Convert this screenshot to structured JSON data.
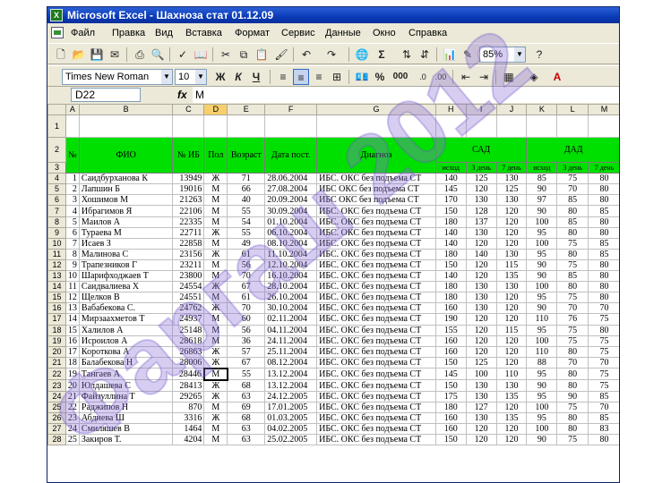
{
  "window": {
    "title": "Microsoft Excel - Шахноза стат 01.12.09",
    "app_icon_letter": "X"
  },
  "menu": [
    "Файл",
    "Правка",
    "Вид",
    "Вставка",
    "Формат",
    "Сервис",
    "Данные",
    "Окно",
    "Справка"
  ],
  "toolbar": {
    "zoom": "85%",
    "font_name": "Times New Roman",
    "font_size": "10",
    "bold": "Ж",
    "italic": "К",
    "underline": "Ч",
    "sigma": "Σ",
    "percent": "%",
    "thousands": "000"
  },
  "formula": {
    "name_box": "D22",
    "fx": "fx",
    "value": "М"
  },
  "columns": [
    "A",
    "B",
    "C",
    "D",
    "E",
    "F",
    "G",
    "H",
    "I",
    "J",
    "K",
    "L",
    "M"
  ],
  "header_row": {
    "num": "№",
    "fio": "ФИО",
    "ib": "№ ИБ",
    "sex": "Пол",
    "age": "Возраст",
    "date": "Дата пост.",
    "diag": "Диагноз",
    "sad": "САД",
    "dad": "ДАД"
  },
  "sub_header": [
    "исход",
    "3 день",
    "7 день",
    "исход",
    "3 день",
    "7 день"
  ],
  "rows": [
    {
      "r": "4",
      "n": "1",
      "fio": "Саидбурханова К",
      "ib": "13949",
      "sex": "Ж",
      "age": "71",
      "date": "28.06.2004",
      "diag": "ИБС. ОКС без подъема СТ",
      "v": [
        "140",
        "125",
        "130",
        "85",
        "75",
        "80"
      ]
    },
    {
      "r": "5",
      "n": "2",
      "fio": "Лапшин Б",
      "ib": "19016",
      "sex": "М",
      "age": "66",
      "date": "27.08.2004",
      "diag": "ИБС ОКС без подъема СТ",
      "v": [
        "145",
        "120",
        "125",
        "90",
        "70",
        "80"
      ]
    },
    {
      "r": "6",
      "n": "3",
      "fio": "Хошимов М",
      "ib": "21263",
      "sex": "М",
      "age": "40",
      "date": "20.09.2004",
      "diag": "ИБС ОКС без подъема СТ",
      "v": [
        "170",
        "130",
        "130",
        "97",
        "85",
        "80"
      ]
    },
    {
      "r": "7",
      "n": "4",
      "fio": "Ибрагимов Я",
      "ib": "22106",
      "sex": "М",
      "age": "55",
      "date": "30.09.2004",
      "diag": "ИБС. ОКС без подъема СТ",
      "v": [
        "150",
        "128",
        "120",
        "90",
        "80",
        "85"
      ]
    },
    {
      "r": "8",
      "n": "5",
      "fio": "Маилов А",
      "ib": "22335",
      "sex": "М",
      "age": "54",
      "date": "01.10.2004",
      "diag": "ИБС. ОКС без подъема СТ",
      "v": [
        "180",
        "137",
        "120",
        "100",
        "85",
        "80"
      ]
    },
    {
      "r": "9",
      "n": "6",
      "fio": "Тураева М",
      "ib": "22711",
      "sex": "Ж",
      "age": "55",
      "date": "06.10.2004",
      "diag": "ИБС. ОКС без подъема СТ",
      "v": [
        "140",
        "130",
        "120",
        "95",
        "80",
        "80"
      ]
    },
    {
      "r": "10",
      "n": "7",
      "fio": "Исаев З",
      "ib": "22858",
      "sex": "М",
      "age": "49",
      "date": "08.10.2004",
      "diag": "ИБС. ОКС без подъема СТ",
      "v": [
        "140",
        "120",
        "120",
        "100",
        "75",
        "85"
      ]
    },
    {
      "r": "11",
      "n": "8",
      "fio": "Малинова С",
      "ib": "23156",
      "sex": "Ж",
      "age": "61",
      "date": "11.10.2004",
      "diag": "ИБС. ОКС без подъема СТ",
      "v": [
        "180",
        "140",
        "130",
        "95",
        "80",
        "85"
      ]
    },
    {
      "r": "12",
      "n": "9",
      "fio": "Трапезников Г",
      "ib": "23211",
      "sex": "М",
      "age": "56",
      "date": "12.10.2004",
      "diag": "ИБС. ОКС без подъема СТ",
      "v": [
        "150",
        "120",
        "115",
        "90",
        "75",
        "80"
      ]
    },
    {
      "r": "13",
      "n": "10",
      "fio": "Шарифходжаев Т",
      "ib": "23800",
      "sex": "М",
      "age": "70",
      "date": "16.10.2004",
      "diag": "ИБС. ОКС без подъема СТ",
      "v": [
        "140",
        "120",
        "135",
        "90",
        "85",
        "80"
      ]
    },
    {
      "r": "14",
      "n": "11",
      "fio": "Саидвалиева Х",
      "ib": "24554",
      "sex": "Ж",
      "age": "67",
      "date": "28.10.2004",
      "diag": "ИБС. ОКС без подъема СТ",
      "v": [
        "180",
        "130",
        "130",
        "100",
        "80",
        "80"
      ]
    },
    {
      "r": "15",
      "n": "12",
      "fio": "Щелков В",
      "ib": "24551",
      "sex": "М",
      "age": "61",
      "date": "26.10.2004",
      "diag": "ИБС. ОКС без подъема СТ",
      "v": [
        "180",
        "130",
        "120",
        "95",
        "75",
        "80"
      ]
    },
    {
      "r": "16",
      "n": "13",
      "fio": "Вабабекова С.",
      "ib": "24762",
      "sex": "Ж",
      "age": "70",
      "date": "30.10.2004",
      "diag": "ИБС. ОКС без подъема СТ",
      "v": [
        "160",
        "130",
        "120",
        "90",
        "70",
        "70"
      ]
    },
    {
      "r": "17",
      "n": "14",
      "fio": "Мирзаахметов Т",
      "ib": "24937",
      "sex": "М",
      "age": "60",
      "date": "02.11.2004",
      "diag": "ИБС. ОКС без подъема СТ",
      "v": [
        "190",
        "120",
        "120",
        "110",
        "76",
        "75"
      ]
    },
    {
      "r": "18",
      "n": "15",
      "fio": "Халилов А",
      "ib": "25148",
      "sex": "М",
      "age": "56",
      "date": "04.11.2004",
      "diag": "ИБС. ОКС без подъема СТ",
      "v": [
        "155",
        "120",
        "115",
        "95",
        "75",
        "80"
      ]
    },
    {
      "r": "19",
      "n": "16",
      "fio": "Исроилов А",
      "ib": "28618",
      "sex": "М",
      "age": "36",
      "date": "24.11.2004",
      "diag": "ИБС. ОКС без подъема СТ",
      "v": [
        "160",
        "120",
        "120",
        "100",
        "75",
        "75"
      ]
    },
    {
      "r": "20",
      "n": "17",
      "fio": "Короткова А",
      "ib": "26863",
      "sex": "Ж",
      "age": "57",
      "date": "25.11.2004",
      "diag": "ИБС. ОКС без подъема СТ",
      "v": [
        "160",
        "120",
        "120",
        "110",
        "80",
        "75"
      ]
    },
    {
      "r": "21",
      "n": "18",
      "fio": "Балабекова Н",
      "ib": "28006",
      "sex": "Ж",
      "age": "67",
      "date": "08.12.2004",
      "diag": "ИБС. ОКС без подъема СТ",
      "v": [
        "150",
        "125",
        "120",
        "88",
        "70",
        "70"
      ]
    },
    {
      "r": "22",
      "n": "19",
      "fio": "Тангаев А",
      "ib": "28446",
      "sex": "М",
      "age": "55",
      "date": "13.12.2004",
      "diag": "ИБС. ОКС без подъема СТ",
      "v": [
        "145",
        "100",
        "110",
        "95",
        "80",
        "75"
      ]
    },
    {
      "r": "23",
      "n": "20",
      "fio": "Юлдашева С",
      "ib": "28413",
      "sex": "Ж",
      "age": "68",
      "date": "13.12.2004",
      "diag": "ИБС. ОКС без подъема СТ",
      "v": [
        "150",
        "130",
        "130",
        "90",
        "80",
        "75"
      ]
    },
    {
      "r": "24",
      "n": "21",
      "fio": "Файзуллина Т",
      "ib": "29265",
      "sex": "Ж",
      "age": "63",
      "date": "24.12.2005",
      "diag": "ИБС. ОКС без подъема СТ",
      "v": [
        "175",
        "130",
        "135",
        "95",
        "90",
        "85"
      ]
    },
    {
      "r": "25",
      "n": "22",
      "fio": "Раджипов Н",
      "ib": "870",
      "sex": "М",
      "age": "69",
      "date": "17.01.2005",
      "diag": "ИБС. ОКС без подъема СТ",
      "v": [
        "180",
        "127",
        "120",
        "100",
        "75",
        "70"
      ]
    },
    {
      "r": "26",
      "n": "23",
      "fio": "Абдиева Ш",
      "ib": "3316",
      "sex": "Ж",
      "age": "68",
      "date": "01.03.2005",
      "diag": "ИБС. ОКС без подъема СТ",
      "v": [
        "160",
        "130",
        "135",
        "95",
        "80",
        "85"
      ]
    },
    {
      "r": "27",
      "n": "24",
      "fio": "Смиляшев В",
      "ib": "1464",
      "sex": "М",
      "age": "63",
      "date": "04.02.2005",
      "diag": "ИБС. ОКС без подъема СТ",
      "v": [
        "160",
        "120",
        "120",
        "100",
        "80",
        "83"
      ]
    },
    {
      "r": "28",
      "n": "25",
      "fio": "Закиров Т.",
      "ib": "4204",
      "sex": "М",
      "age": "63",
      "date": "25.02.2005",
      "diag": "ИБС. ОКС без подъема СТ",
      "v": [
        "150",
        "120",
        "120",
        "90",
        "75",
        "80"
      ]
    }
  ],
  "watermark": "Фаргаш 2012"
}
